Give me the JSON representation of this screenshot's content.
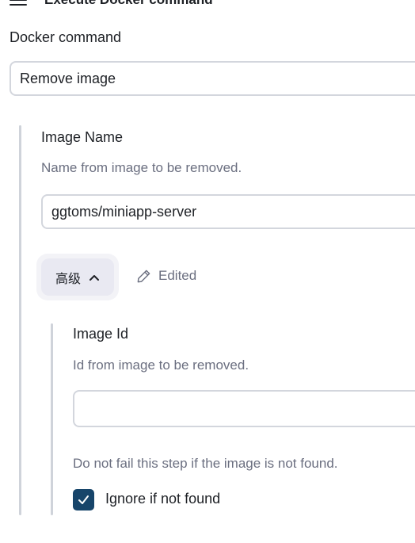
{
  "header": {
    "title": "Execute Docker command",
    "menu_icon": "hamburger-menu-icon"
  },
  "docker_command": {
    "label": "Docker command",
    "value": "Remove image"
  },
  "image_name": {
    "label": "Image Name",
    "description": "Name from image to be removed.",
    "value": "ggtoms/miniapp-server"
  },
  "advanced": {
    "button_label": "高级",
    "expanded_icon": "chevron-up-icon",
    "edited_icon": "pencil-icon",
    "edited_label": "Edited"
  },
  "image_id": {
    "label": "Image Id",
    "description": "Id from image to be removed.",
    "value": ""
  },
  "ignore": {
    "description": "Do not fail this step if the image is not found.",
    "label": "Ignore if not found",
    "checked": true
  },
  "colors": {
    "checkbox": "#17456a",
    "advanced_button": "#e9e9f2",
    "border": "#d3d6dd",
    "muted_text": "#6b6f80"
  }
}
